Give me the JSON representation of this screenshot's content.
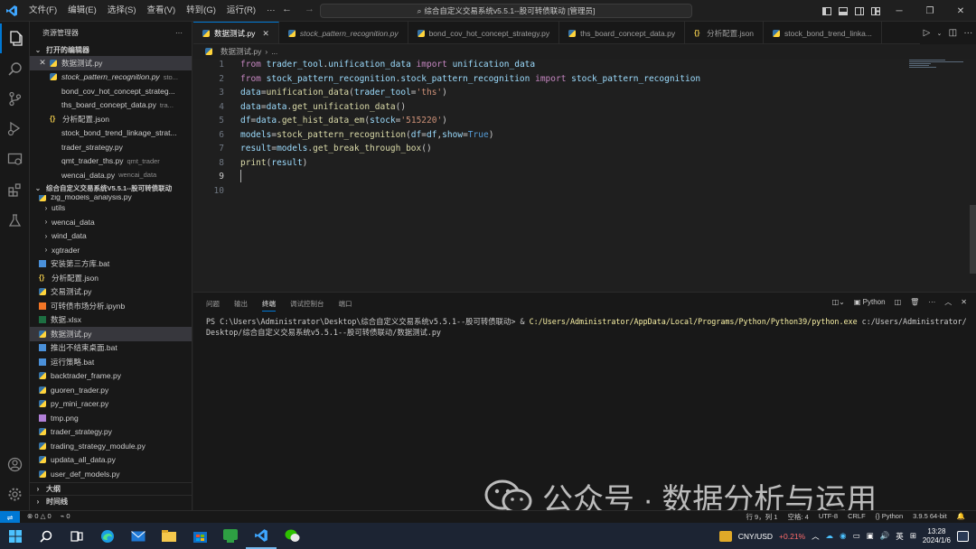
{
  "titlebar": {
    "menu": [
      "文件(F)",
      "编辑(E)",
      "选择(S)",
      "查看(V)",
      "转到(G)",
      "运行(R)",
      "···"
    ],
    "search_text": "综合自定义交易系统v5.5.1--股可转债联动 [管理员]"
  },
  "sidebar": {
    "title": "资源管理器",
    "open_editors_label": "打开的编辑器",
    "open_editors": [
      {
        "name": "数据测试.py",
        "desc": "",
        "icon": "python",
        "selected": true,
        "close": true
      },
      {
        "name": "stock_pattern_recognition.py",
        "desc": "sto...",
        "icon": "python",
        "italic": true
      },
      {
        "name": "bond_cov_hot_concept_strateg...",
        "desc": "",
        "icon": "none"
      },
      {
        "name": "ths_board_concept_data.py",
        "desc": "tra...",
        "icon": "none"
      },
      {
        "name": "分析配置.json",
        "desc": "",
        "icon": "json"
      },
      {
        "name": "stock_bond_trend_linkage_strat...",
        "desc": "",
        "icon": "none"
      },
      {
        "name": "trader_strategy.py",
        "desc": "",
        "icon": "none"
      },
      {
        "name": "qmt_trader_ths.py",
        "desc": "qmt_trader",
        "icon": "none"
      },
      {
        "name": "wencai_data.py",
        "desc": "wencai_data",
        "icon": "none"
      }
    ],
    "workspace_label": "综合自定义交易系统V5.5.1--股可转债联动",
    "files": [
      {
        "name": "zig_models_analysis.py",
        "type": "partial"
      },
      {
        "name": "utils",
        "type": "folder"
      },
      {
        "name": "wencai_data",
        "type": "folder"
      },
      {
        "name": "wind_data",
        "type": "folder"
      },
      {
        "name": "xgtrader",
        "type": "folder"
      },
      {
        "name": "安装第三方库.bat",
        "type": "bat"
      },
      {
        "name": "分析配置.json",
        "type": "json"
      },
      {
        "name": "交易测试.py",
        "type": "py"
      },
      {
        "name": "可转债市场分析.ipynb",
        "type": "ipynb"
      },
      {
        "name": "数据.xlsx",
        "type": "xlsx"
      },
      {
        "name": "数据测试.py",
        "type": "py",
        "selected": true
      },
      {
        "name": "推出不结束桌面.bat",
        "type": "bat"
      },
      {
        "name": "运行策略.bat",
        "type": "bat"
      },
      {
        "name": "backtrader_frame.py",
        "type": "py"
      },
      {
        "name": "guoren_trader.py",
        "type": "py"
      },
      {
        "name": "py_mini_racer.py",
        "type": "py"
      },
      {
        "name": "tmp.png",
        "type": "png"
      },
      {
        "name": "trader_strategy.py",
        "type": "py"
      },
      {
        "name": "trading_strategy_module.py",
        "type": "py"
      },
      {
        "name": "updata_all_data.py",
        "type": "py"
      },
      {
        "name": "user_def_models.py",
        "type": "partial"
      }
    ],
    "outline_label": "大纲",
    "timeline_label": "时间线"
  },
  "tabs": [
    {
      "label": "数据测试.py",
      "active": true
    },
    {
      "label": "stock_pattern_recognition.py"
    },
    {
      "label": "bond_cov_hot_concept_strategy.py"
    },
    {
      "label": "ths_board_concept_data.py"
    },
    {
      "label": "分析配置.json"
    },
    {
      "label": "stock_bond_trend_linka..."
    }
  ],
  "breadcrumb": {
    "file": "数据测试.py",
    "rest": "..."
  },
  "editor": {
    "line_numbers": [
      "1",
      "2",
      "3",
      "4",
      "5",
      "6",
      "7",
      "8",
      "9",
      "10"
    ],
    "current_line": 9
  },
  "panel": {
    "tabs": [
      "问题",
      "输出",
      "终端",
      "调试控制台",
      "端口"
    ],
    "active_tab": "终端",
    "shell_label": "Python",
    "terminal_prompt": "PS C:\\Users\\Administrator\\Desktop\\综合自定义交易系统v5.5.1--股可转债联动> & ",
    "terminal_cmd": "C:/Users/Administrator/AppData/Local/Programs/Python/Python39/python.exe",
    "terminal_arg": " c:/Users/Administrator/Desktop/综合自定义交易系统v5.5.1--股可转债联动/数据测试.py"
  },
  "statusbar": {
    "errors": "0",
    "warnings": "0",
    "ports": "0",
    "position": "行 9，列 1",
    "spaces": "空格: 4",
    "encoding": "UTF-8",
    "eol": "CRLF",
    "language": "Python",
    "interpreter": "3.9.5 64-bit"
  },
  "taskbar": {
    "stock_name": "CNY/USD",
    "stock_change": "+0.21%",
    "ime": "英",
    "time": "13:28",
    "date": "2024/1/6"
  },
  "watermark": {
    "text": "公众号 · 数据分析与运用"
  },
  "colors": {
    "accent": "#0078d4",
    "keyword": "#c586c0",
    "string": "#ce9178",
    "function": "#dcdcaa",
    "variable": "#9cdcfe"
  }
}
